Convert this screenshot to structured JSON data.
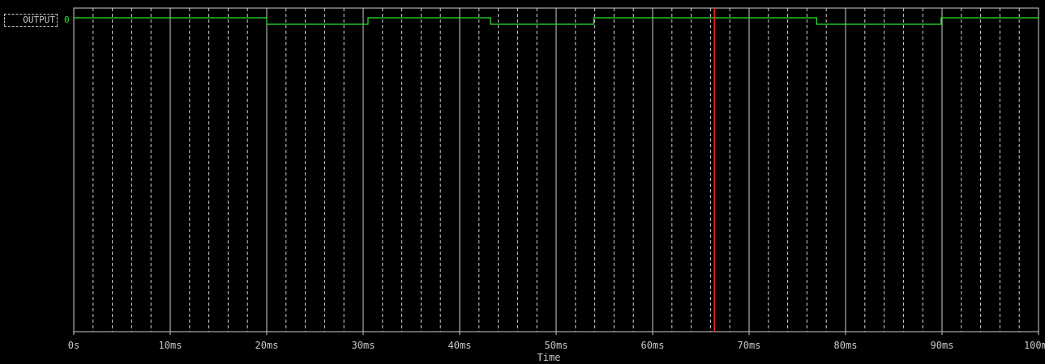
{
  "signal": {
    "name": "OUTPUT",
    "value": "0"
  },
  "colors": {
    "background": "#000000",
    "grid": "#d0d0d0",
    "trace": "#2ee82e",
    "cursor": "#ff2020",
    "text": "#c8c8c8"
  },
  "chart_data": {
    "type": "line",
    "title": "",
    "xlabel": "Time",
    "ylabel": "",
    "xunit": "ms",
    "xlim": [
      0,
      100
    ],
    "ylim": [
      0,
      1
    ],
    "major_ticks": [
      0,
      10,
      20,
      30,
      40,
      50,
      60,
      70,
      80,
      90,
      100
    ],
    "tick_labels": [
      "0s",
      "10ms",
      "20ms",
      "30ms",
      "40ms",
      "50ms",
      "60ms",
      "70ms",
      "80ms",
      "90ms",
      "100ms"
    ],
    "minor_tick_step": 2,
    "grid": true,
    "cursor_x": 66.4,
    "series": [
      {
        "name": "OUTPUT",
        "x": [
          0,
          20.0,
          20.0,
          30.5,
          30.5,
          43.2,
          43.2,
          53.9,
          53.9,
          77.0,
          77.0,
          89.9,
          89.9,
          100
        ],
        "y": [
          1,
          1,
          0,
          0,
          1,
          1,
          0,
          0,
          1,
          1,
          0,
          0,
          1,
          1
        ]
      }
    ]
  }
}
